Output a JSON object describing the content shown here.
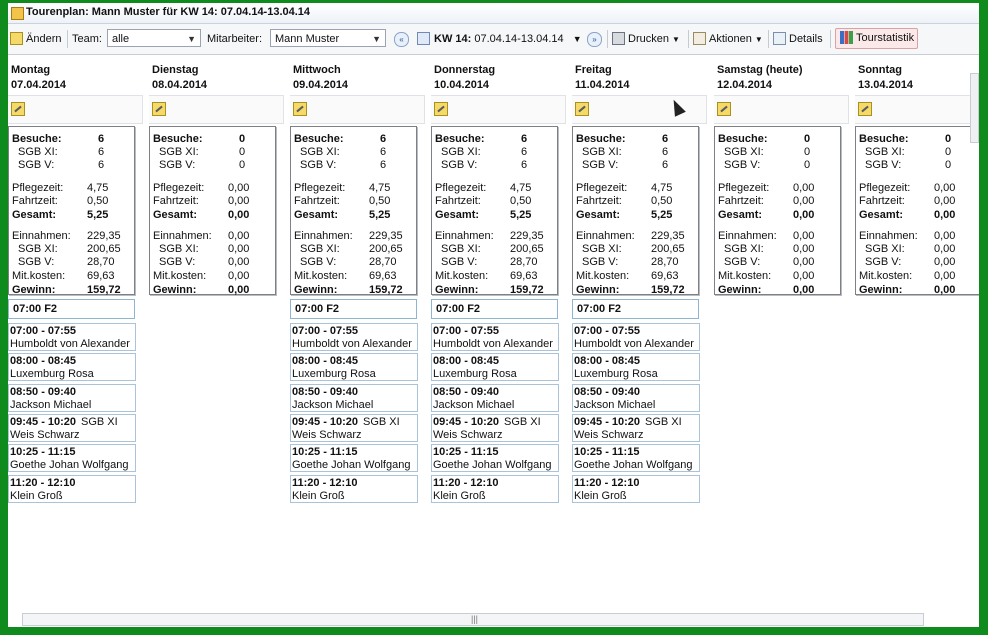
{
  "title": "Tourenplan: Mann Muster für KW 14: 07.04.14-13.04.14",
  "toolbar": {
    "edit_label": "Ändern",
    "team_label": "Team:",
    "team_value": "alle",
    "employee_label": "Mitarbeiter:",
    "employee_value": "Mann Muster",
    "kw_label": "KW 14:",
    "kw_value": "07.04.14-13.04.14",
    "print_label": "Drucken",
    "actions_label": "Aktionen",
    "details_label": "Details",
    "stat_label": "Tourstatistik"
  },
  "stat_labels": {
    "visits": "Besuche:",
    "sgb_xi": "SGB XI:",
    "sgb_v": "SGB V:",
    "care_time": "Pflegezeit:",
    "travel_time": "Fahrtzeit:",
    "total": "Gesamt:",
    "income": "Einnahmen:",
    "income_sgb_xi": "SGB XI:",
    "income_sgb_v": "SGB V:",
    "costs": "Mit.kosten:",
    "profit": "Gewinn:"
  },
  "days": [
    {
      "name": "Montag",
      "date": "07.04.2014",
      "stats": {
        "visits": "6",
        "sgb_xi": "6",
        "sgb_v": "6",
        "care_time": "4,75",
        "travel_time": "0,50",
        "total": "5,25",
        "income": "229,35",
        "income_sgb_xi": "200,65",
        "income_sgb_v": "28,70",
        "costs": "69,63",
        "profit": "159,72"
      },
      "slot": "07:00  F2",
      "appointments": [
        {
          "time": "07:00 - 07:55",
          "name": "Humboldt von Alexander",
          "tag": ""
        },
        {
          "time": "08:00 - 08:45",
          "name": "Luxemburg Rosa",
          "tag": ""
        },
        {
          "time": "08:50 - 09:40",
          "name": "Jackson Michael",
          "tag": ""
        },
        {
          "time": "09:45 - 10:20",
          "name": "Weis Schwarz",
          "tag": "SGB XI"
        },
        {
          "time": "10:25 - 11:15",
          "name": "Goethe Johan Wolfgang",
          "tag": ""
        },
        {
          "time": "11:20 - 12:10",
          "name": "Klein Groß",
          "tag": ""
        }
      ]
    },
    {
      "name": "Dienstag",
      "date": "08.04.2014",
      "stats": {
        "visits": "0",
        "sgb_xi": "0",
        "sgb_v": "0",
        "care_time": "0,00",
        "travel_time": "0,00",
        "total": "0,00",
        "income": "0,00",
        "income_sgb_xi": "0,00",
        "income_sgb_v": "0,00",
        "costs": "0,00",
        "profit": "0,00"
      },
      "slot": "",
      "appointments": []
    },
    {
      "name": "Mittwoch",
      "date": "09.04.2014",
      "stats": {
        "visits": "6",
        "sgb_xi": "6",
        "sgb_v": "6",
        "care_time": "4,75",
        "travel_time": "0,50",
        "total": "5,25",
        "income": "229,35",
        "income_sgb_xi": "200,65",
        "income_sgb_v": "28,70",
        "costs": "69,63",
        "profit": "159,72"
      },
      "slot": "07:00  F2",
      "appointments": [
        {
          "time": "07:00 - 07:55",
          "name": "Humboldt von Alexander",
          "tag": ""
        },
        {
          "time": "08:00 - 08:45",
          "name": "Luxemburg Rosa",
          "tag": ""
        },
        {
          "time": "08:50 - 09:40",
          "name": "Jackson Michael",
          "tag": ""
        },
        {
          "time": "09:45 - 10:20",
          "name": "Weis Schwarz",
          "tag": "SGB XI"
        },
        {
          "time": "10:25 - 11:15",
          "name": "Goethe Johan Wolfgang",
          "tag": ""
        },
        {
          "time": "11:20 - 12:10",
          "name": "Klein Groß",
          "tag": ""
        }
      ]
    },
    {
      "name": "Donnerstag",
      "date": "10.04.2014",
      "stats": {
        "visits": "6",
        "sgb_xi": "6",
        "sgb_v": "6",
        "care_time": "4,75",
        "travel_time": "0,50",
        "total": "5,25",
        "income": "229,35",
        "income_sgb_xi": "200,65",
        "income_sgb_v": "28,70",
        "costs": "69,63",
        "profit": "159,72"
      },
      "slot": "07:00  F2",
      "appointments": [
        {
          "time": "07:00 - 07:55",
          "name": "Humboldt von Alexander",
          "tag": ""
        },
        {
          "time": "08:00 - 08:45",
          "name": "Luxemburg Rosa",
          "tag": ""
        },
        {
          "time": "08:50 - 09:40",
          "name": "Jackson Michael",
          "tag": ""
        },
        {
          "time": "09:45 - 10:20",
          "name": "Weis Schwarz",
          "tag": "SGB XI"
        },
        {
          "time": "10:25 - 11:15",
          "name": "Goethe Johan Wolfgang",
          "tag": ""
        },
        {
          "time": "11:20 - 12:10",
          "name": "Klein Groß",
          "tag": ""
        }
      ]
    },
    {
      "name": "Freitag",
      "date": "11.04.2014",
      "stats": {
        "visits": "6",
        "sgb_xi": "6",
        "sgb_v": "6",
        "care_time": "4,75",
        "travel_time": "0,50",
        "total": "5,25",
        "income": "229,35",
        "income_sgb_xi": "200,65",
        "income_sgb_v": "28,70",
        "costs": "69,63",
        "profit": "159,72"
      },
      "slot": "07:00  F2",
      "appointments": [
        {
          "time": "07:00 - 07:55",
          "name": "Humboldt von Alexander",
          "tag": ""
        },
        {
          "time": "08:00 - 08:45",
          "name": "Luxemburg Rosa",
          "tag": ""
        },
        {
          "time": "08:50 - 09:40",
          "name": "Jackson Michael",
          "tag": ""
        },
        {
          "time": "09:45 - 10:20",
          "name": "Weis Schwarz",
          "tag": "SGB XI"
        },
        {
          "time": "10:25 - 11:15",
          "name": "Goethe Johan Wolfgang",
          "tag": ""
        },
        {
          "time": "11:20 - 12:10",
          "name": "Klein Groß",
          "tag": ""
        }
      ]
    },
    {
      "name": "Samstag (heute)",
      "date": "12.04.2014",
      "stats": {
        "visits": "0",
        "sgb_xi": "0",
        "sgb_v": "0",
        "care_time": "0,00",
        "travel_time": "0,00",
        "total": "0,00",
        "income": "0,00",
        "income_sgb_xi": "0,00",
        "income_sgb_v": "0,00",
        "costs": "0,00",
        "profit": "0,00"
      },
      "slot": "",
      "appointments": []
    },
    {
      "name": "Sonntag",
      "date": "13.04.2014",
      "stats": {
        "visits": "0",
        "sgb_xi": "0",
        "sgb_v": "0",
        "care_time": "0,00",
        "travel_time": "0,00",
        "total": "0,00",
        "income": "0,00",
        "income_sgb_xi": "0,00",
        "income_sgb_v": "0,00",
        "costs": "0,00",
        "profit": "0,00"
      },
      "slot": "",
      "appointments": []
    }
  ],
  "colors": {
    "frame": "#0f8a1c",
    "appointment_border": "#a9c4d8",
    "stat_highlight": "#fbe9e9"
  },
  "icons": [
    "app-icon",
    "edit-icon",
    "prev-week-icon",
    "calendar-icon",
    "next-week-icon",
    "printer-icon",
    "actions-icon",
    "details-icon",
    "chart-icon",
    "pencil-icon"
  ]
}
